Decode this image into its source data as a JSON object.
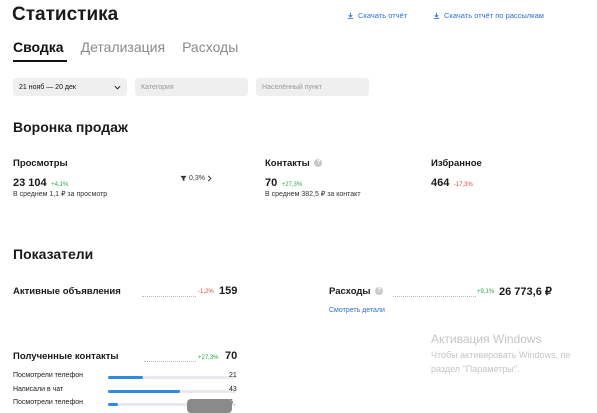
{
  "page": {
    "title": "Статистика",
    "download_report": "Скачать отчёт",
    "download_mailing_report": "Скачать отчёт по рассылкам"
  },
  "tabs": [
    {
      "label": "Сводка",
      "active": true
    },
    {
      "label": "Детализация",
      "active": false
    },
    {
      "label": "Расходы",
      "active": false
    }
  ],
  "filters": {
    "date_range": "21 нояб — 20 дек",
    "category_placeholder": "Категория",
    "city_placeholder": "Населённый пункт"
  },
  "funnel": {
    "heading": "Воронка продаж",
    "views": {
      "label": "Просмотры",
      "value": "23 104",
      "change": "+4,1%",
      "avg": "В среднем 1,1 ₽ за просмотр"
    },
    "conversion": {
      "value": "0,3%"
    },
    "contacts": {
      "label": "Контакты",
      "value": "70",
      "change": "+27,3%",
      "avg": "В среднем 382,5 ₽ за контакт"
    },
    "favorites": {
      "label": "Избранное",
      "value": "464",
      "change": "-17,3%"
    }
  },
  "indicators": {
    "heading": "Показатели",
    "active_ads": {
      "label": "Активные объявления",
      "change": "-1,2%",
      "value": "159"
    },
    "expenses": {
      "label": "Расходы",
      "change": "+9,1%",
      "value": "26 773,6 ₽",
      "details_link": "Смотреть детали"
    },
    "received_contacts": {
      "label": "Полученные контакты",
      "change": "+27,3%",
      "value": "70",
      "rows": [
        {
          "label": "Посмотрели телефон",
          "value": "21",
          "fraction": 0.49
        },
        {
          "label": "Написали в чат",
          "value": "43",
          "fraction": 1.0
        },
        {
          "label": "Посмотрели телефон",
          "value": "6",
          "fraction": 0.14
        }
      ]
    }
  },
  "watermark": {
    "line1": "Активация Windows",
    "line2": "Чтобы активировать Windows, пе",
    "line3": "раздел \"Параметры\"."
  },
  "colors": {
    "accent": "#2f6fd1",
    "positive": "#28a745",
    "negative": "#e0403c",
    "bar": "#2f8be0"
  }
}
